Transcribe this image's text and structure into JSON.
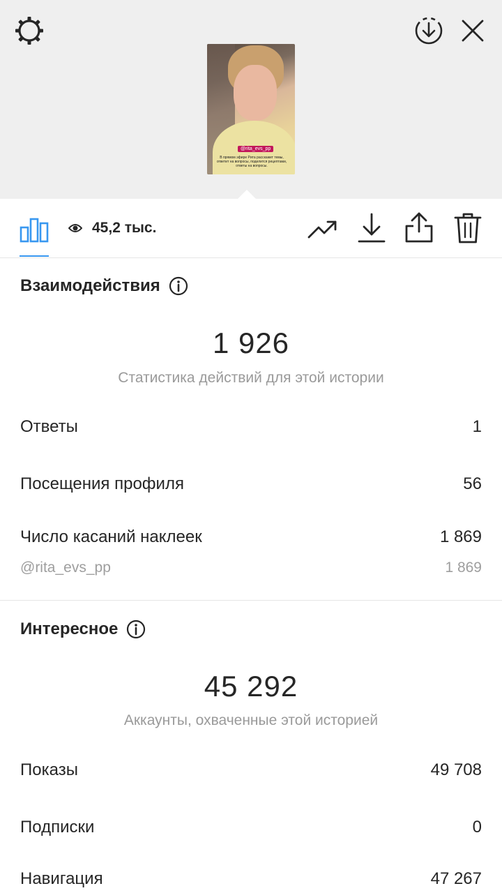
{
  "header": {
    "settings_icon": "gear-icon",
    "download_circle_icon": "download-circle-icon",
    "close_icon": "close-icon"
  },
  "story": {
    "sticker_tag": "@rita_evs_pp",
    "caption": "В прямом эфире Рита расскажет темы, ответит на вопросы, поделится рецептами, ответы на вопросы."
  },
  "toolbar": {
    "views_count": "45,2 тыс.",
    "icons": [
      "bar-chart-icon",
      "eye-icon",
      "trending-icon",
      "download-icon",
      "share-icon",
      "trash-icon"
    ]
  },
  "interactions": {
    "title": "Взаимодействия",
    "total": "1 926",
    "caption": "Статистика действий для этой истории",
    "rows": [
      {
        "label": "Ответы",
        "value": "1"
      },
      {
        "label": "Посещения профиля",
        "value": "56"
      },
      {
        "label": "Число касаний наклеек",
        "value": "1 869"
      }
    ],
    "sub_row": {
      "label": "@rita_evs_pp",
      "value": "1 869"
    }
  },
  "discovery": {
    "title": "Интересное",
    "total": "45 292",
    "caption": "Аккаунты, охваченные этой историей",
    "rows": [
      {
        "label": "Показы",
        "value": "49 708"
      },
      {
        "label": "Подписки",
        "value": "0"
      },
      {
        "label": "Навигация",
        "value": "47 267"
      }
    ]
  },
  "colors": {
    "accent": "#3897f0",
    "top_background": "#efefef",
    "muted_text": "#9a9a9a"
  }
}
